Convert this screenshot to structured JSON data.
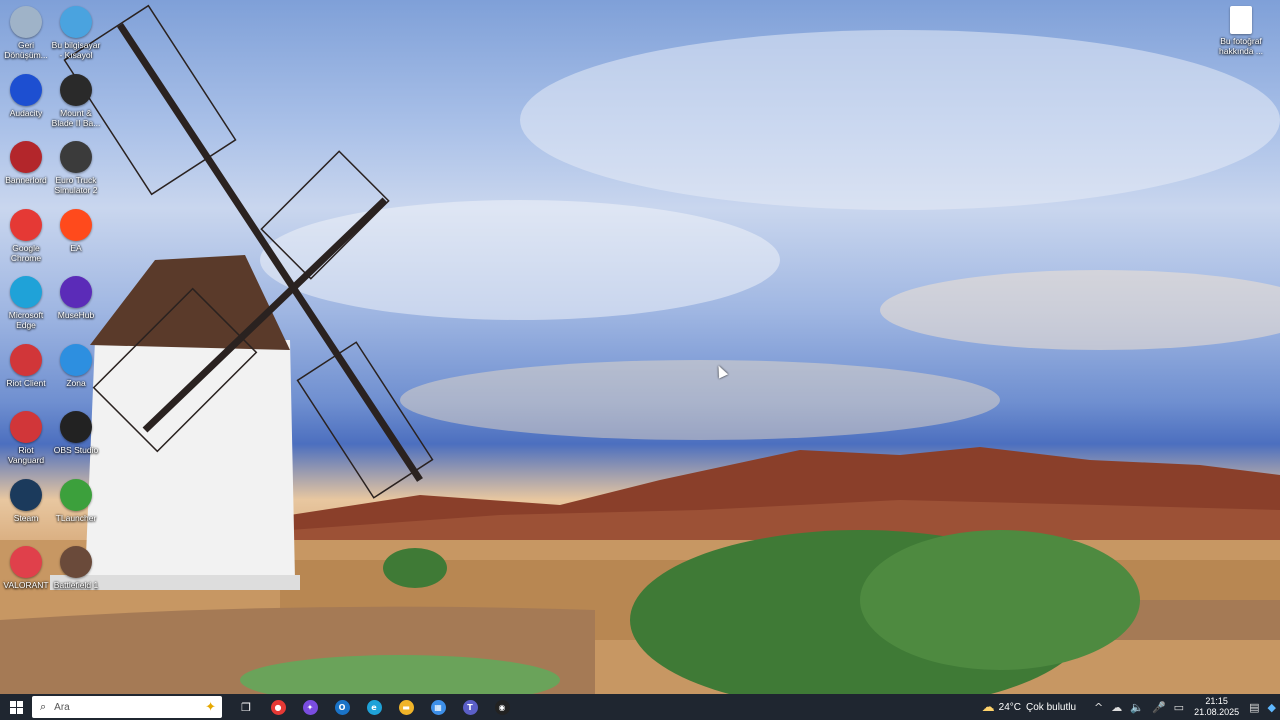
{
  "desktop": {
    "wallpaper": "windmill-landscape",
    "left_icons": [
      {
        "label": "Geri Dönüşüm...",
        "icon": "recycle-bin-icon",
        "color": "#9fb3c8"
      },
      {
        "label": "Bu bilgisayar - Kısayol",
        "icon": "this-pc-icon",
        "color": "#4aa3df"
      },
      {
        "label": "Audacity",
        "icon": "audacity-icon",
        "color": "#1d4fd1"
      },
      {
        "label": "Mount & Blade II Ba...",
        "icon": "bannerlord-icon",
        "color": "#2a2a2a"
      },
      {
        "label": "Bannerlord",
        "icon": "bannerlord-launcher-icon",
        "color": "#b3262b"
      },
      {
        "label": "Euro Truck Simulator 2",
        "icon": "truck-icon",
        "color": "#3b3b3b"
      },
      {
        "label": "Google Chrome",
        "icon": "chrome-icon",
        "color": "#e53935"
      },
      {
        "label": "EA",
        "icon": "ea-icon",
        "color": "#ff4a1c"
      },
      {
        "label": "Microsoft Edge",
        "icon": "edge-icon",
        "color": "#1fa2d8"
      },
      {
        "label": "MuseHub",
        "icon": "musehub-icon",
        "color": "#5b2bb8"
      },
      {
        "label": "Riot Client",
        "icon": "riot-client-icon",
        "color": "#d13639"
      },
      {
        "label": "Zona",
        "icon": "zona-icon",
        "color": "#2d8fe0"
      },
      {
        "label": "Riot Vanguard",
        "icon": "riot-vanguard-icon",
        "color": "#d13639"
      },
      {
        "label": "OBS Studio",
        "icon": "obs-icon",
        "color": "#222"
      },
      {
        "label": "Steam",
        "icon": "steam-icon",
        "color": "#1b3a5c"
      },
      {
        "label": "TLauncher",
        "icon": "tlauncher-icon",
        "color": "#3ca03c"
      },
      {
        "label": "VALORANT",
        "icon": "valorant-icon",
        "color": "#e0404b"
      },
      {
        "label": "Battlefield 1",
        "icon": "battlefield-icon",
        "color": "#6a4a3a"
      }
    ],
    "right_icon": {
      "label": "Bu fotoğraf hakkında ...",
      "icon": "file-icon"
    }
  },
  "taskbar": {
    "start": "start-icon",
    "search_placeholder": "Ara",
    "task_view": "task-view-icon",
    "apps": [
      {
        "name": "chrome",
        "color": "#e53935",
        "glyph": "●"
      },
      {
        "name": "copilot",
        "color": "#7a4de0",
        "glyph": "✦"
      },
      {
        "name": "outlook",
        "color": "#1a73c7",
        "glyph": "O"
      },
      {
        "name": "edge",
        "color": "#1fa2d8",
        "glyph": "e"
      },
      {
        "name": "file-explorer",
        "color": "#f0b429",
        "glyph": "▬"
      },
      {
        "name": "store",
        "color": "#3d8fe8",
        "glyph": "▦"
      },
      {
        "name": "teams",
        "color": "#5b5fc7",
        "glyph": "T"
      },
      {
        "name": "obs",
        "color": "#222",
        "glyph": "◉"
      }
    ],
    "weather": {
      "temp": "24°C",
      "desc": "Çok bulutlu"
    },
    "clock": {
      "time": "21:15",
      "date": "21.08.2025"
    }
  }
}
